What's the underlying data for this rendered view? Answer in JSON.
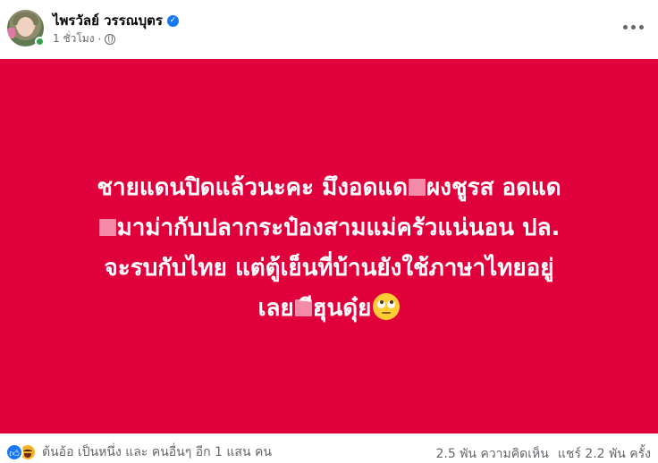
{
  "post": {
    "author_name": "ไพรวัลย์ วรรณบุตร",
    "time_ago": "1 ชั่วโมง",
    "separator": "·",
    "verified": true,
    "lines": [
      [
        "ชายแดนปิดแล้วนะคะ มึงอดแด",
        "ผงชูรส อดแด"
      ],
      [
        "มาม่ากับปลากระป๋องสามแม่ครัวแน่นอน ปล."
      ],
      [
        "จะรบกับไทย แต่ตู้เย็นที่บ้านยังใช้ภาษาไทยอยู่"
      ],
      [
        "เลย",
        "ีฮุนดุ๋ย"
      ]
    ],
    "background_color": "#e0003c",
    "text_color": "#ffffff",
    "censor_color": "#f38aa8"
  },
  "footer": {
    "reaction_summary": "ต้นอ้อ เป็นหนึ่ง และ คนอื่นๆ อีก 1 แสน คน",
    "comments": "2.5 พัน ความคิดเห็น",
    "shares": "แชร์ 2.2 พัน ครั้ง"
  },
  "icons": {
    "verified": "verified-badge-icon",
    "privacy": "globe-icon",
    "more": "more-options-icon",
    "reactions": [
      "like-icon",
      "haha-icon"
    ],
    "emoji": "face-with-rolling-eyes-icon"
  },
  "colors": {
    "accent": "#1877f2",
    "secondary_text": "#65676b"
  }
}
